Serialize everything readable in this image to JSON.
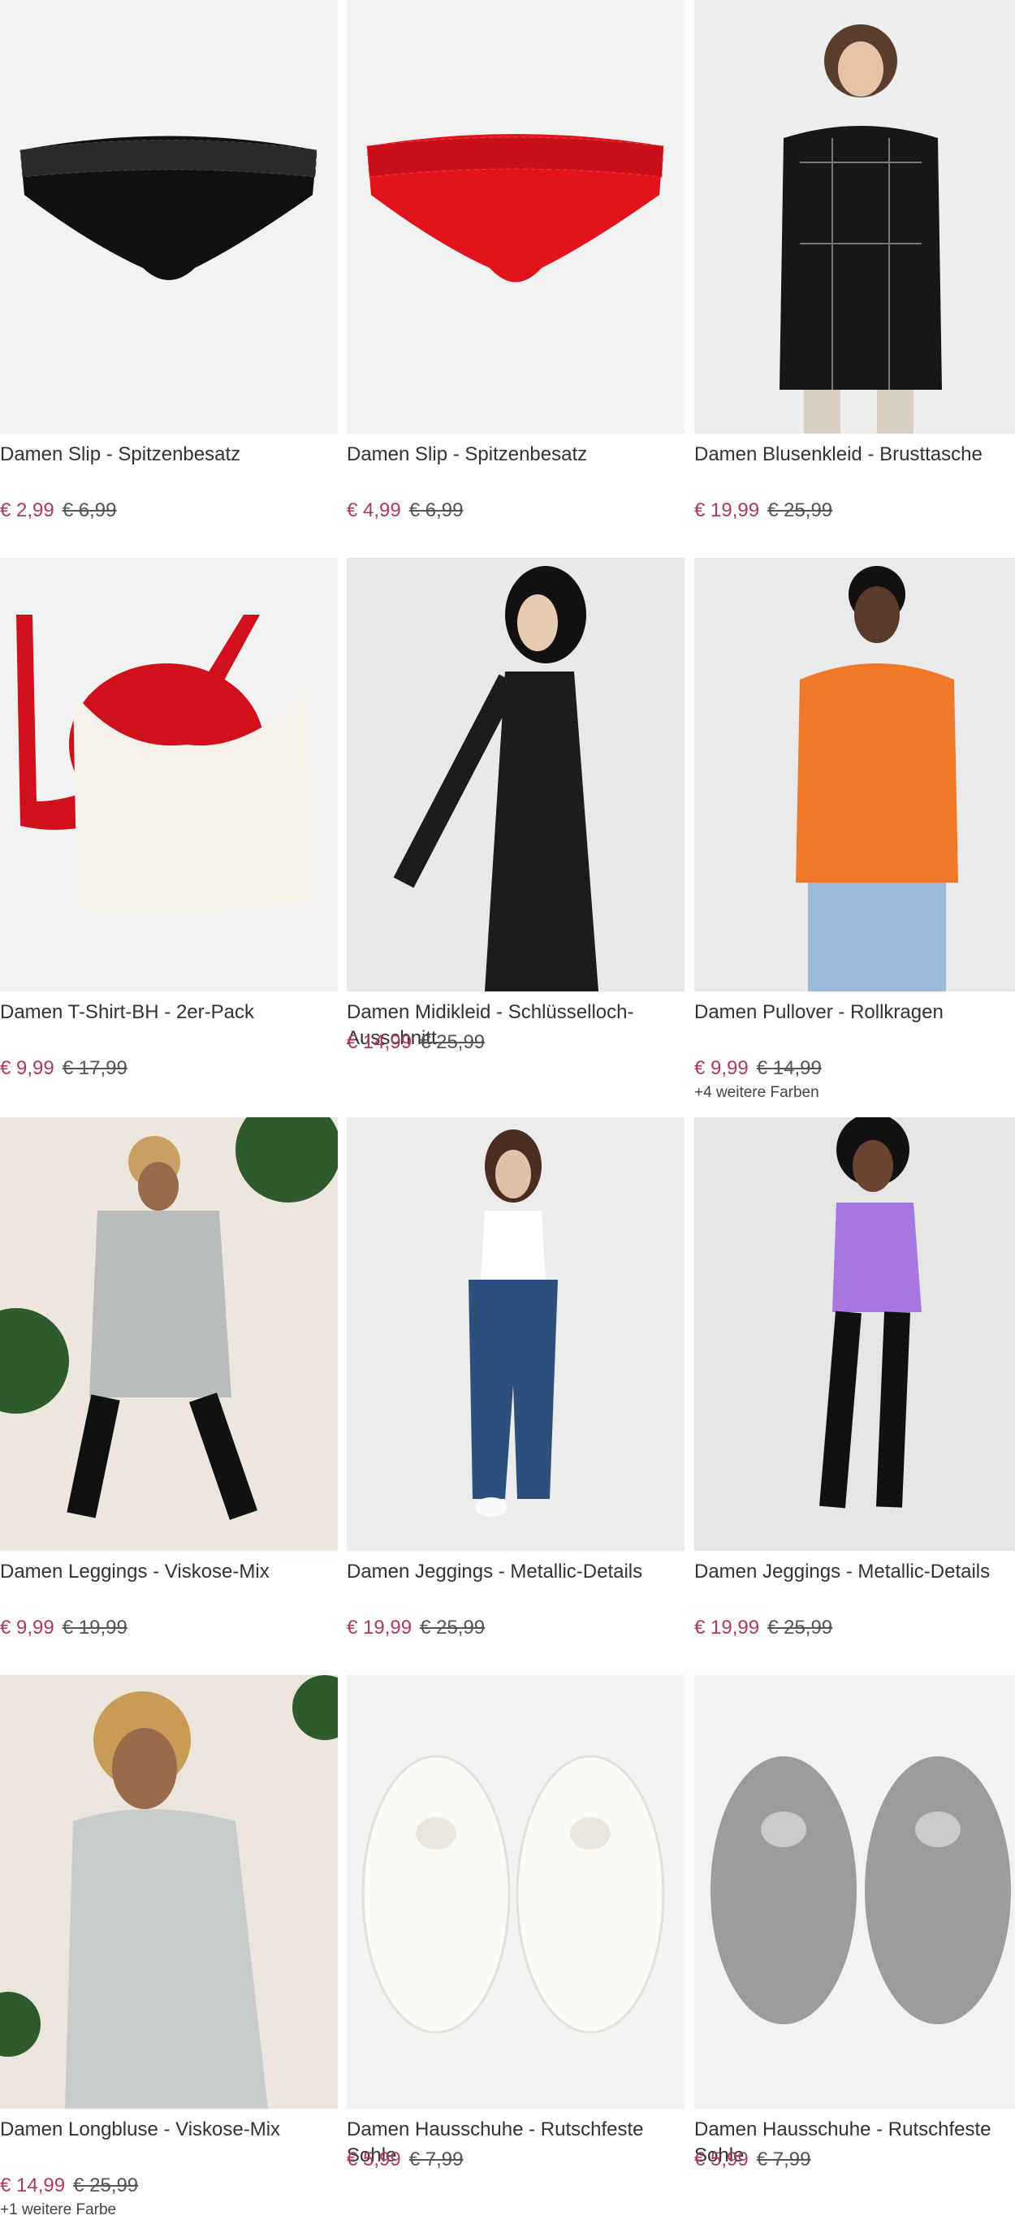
{
  "products": [
    {
      "title": "Damen Slip - Spitzenbesatz",
      "price": "€ 2,99",
      "old_price": "€ 6,99",
      "colors": ""
    },
    {
      "title": "Damen Slip - Spitzenbesatz",
      "price": "€ 4,99",
      "old_price": "€ 6,99",
      "colors": ""
    },
    {
      "title": "Damen Blusenkleid - Brusttasche",
      "price": "€ 19,99",
      "old_price": "€ 25,99",
      "colors": ""
    },
    {
      "title": "Damen T-Shirt-BH - 2er-Pack",
      "price": "€ 9,99",
      "old_price": "€ 17,99",
      "colors": ""
    },
    {
      "title": "Damen Midikleid - Schlüsselloch-Ausschnitt",
      "price": "€ 14,99",
      "old_price": "€ 25,99",
      "colors": ""
    },
    {
      "title": "Damen Pullover - Rollkragen",
      "price": "€ 9,99",
      "old_price": "€ 14,99",
      "colors": "+4 weitere Farben"
    },
    {
      "title": "Damen Leggings - Viskose-Mix",
      "price": "€ 9,99",
      "old_price": "€ 19,99",
      "colors": ""
    },
    {
      "title": "Damen Jeggings - Metallic-Details",
      "price": "€ 19,99",
      "old_price": "€ 25,99",
      "colors": ""
    },
    {
      "title": "Damen Jeggings - Metallic-Details",
      "price": "€ 19,99",
      "old_price": "€ 25,99",
      "colors": ""
    },
    {
      "title": "Damen Longbluse - Viskose-Mix",
      "price": "€ 14,99",
      "old_price": "€ 25,99",
      "colors": "+1 weitere Farbe"
    },
    {
      "title": "Damen Hausschuhe - Rutschfeste Sohle",
      "price": "€ 5,99",
      "old_price": "€ 7,99",
      "colors": ""
    },
    {
      "title": "Damen Hausschuhe - Rutschfeste Sohle",
      "price": "€ 5,99",
      "old_price": "€ 7,99",
      "colors": ""
    }
  ],
  "colors": {
    "price_accent": "#b03a5b",
    "image_bg": "#f1f1f1"
  }
}
